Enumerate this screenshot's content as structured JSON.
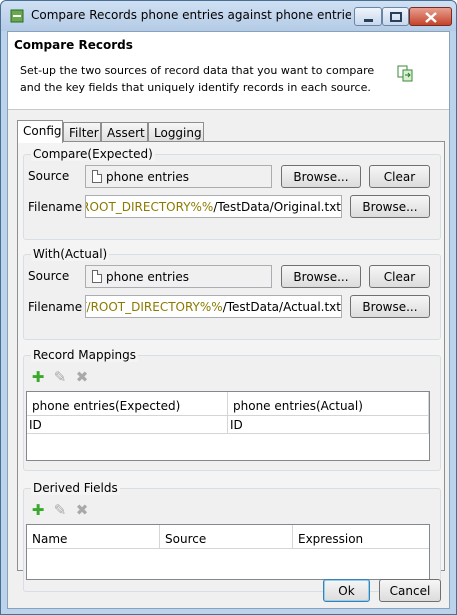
{
  "window": {
    "title": "Compare Records phone entries against phone entries [tes..."
  },
  "header": {
    "title": "Compare Records",
    "description": "Set-up the two sources of record data that you want to compare and the key fields that uniquely identify records in each source."
  },
  "tabs": [
    {
      "label": "Config",
      "active": true
    },
    {
      "label": "Filter",
      "active": false
    },
    {
      "label": "Assert",
      "active": false
    },
    {
      "label": "Logging",
      "active": false
    }
  ],
  "expected": {
    "group_label": "Compare(Expected)",
    "source_label": "Source",
    "source_value": "phone entries",
    "browse_label": "Browse...",
    "clear_label": "Clear",
    "filename_label": "Filename",
    "filename_prefix": "%%PROJECT/ROOT_DIRECTORY%%",
    "filename_suffix": "/TestData/Original.txt",
    "filename_browse_label": "Browse..."
  },
  "actual": {
    "group_label": "With(Actual)",
    "source_label": "Source",
    "source_value": "phone entries",
    "browse_label": "Browse...",
    "clear_label": "Clear",
    "filename_label": "Filename",
    "filename_prefix": "%%PROJECT/ROOT_DIRECTORY%%",
    "filename_suffix": "/TestData/Actual.txt",
    "filename_browse_label": "Browse..."
  },
  "mappings": {
    "group_label": "Record Mappings",
    "columns": [
      "phone entries(Expected)",
      "phone entries(Actual)"
    ],
    "rows": [
      [
        "ID",
        "ID"
      ]
    ]
  },
  "derived": {
    "group_label": "Derived Fields",
    "columns": [
      "Name",
      "Source",
      "Expression"
    ],
    "rows": []
  },
  "footer": {
    "ok_label": "Ok",
    "cancel_label": "Cancel"
  },
  "colors": {
    "titlebar": "#bcd3ec",
    "path_variable": "#8c7a00",
    "add_icon": "#3aa82a"
  }
}
